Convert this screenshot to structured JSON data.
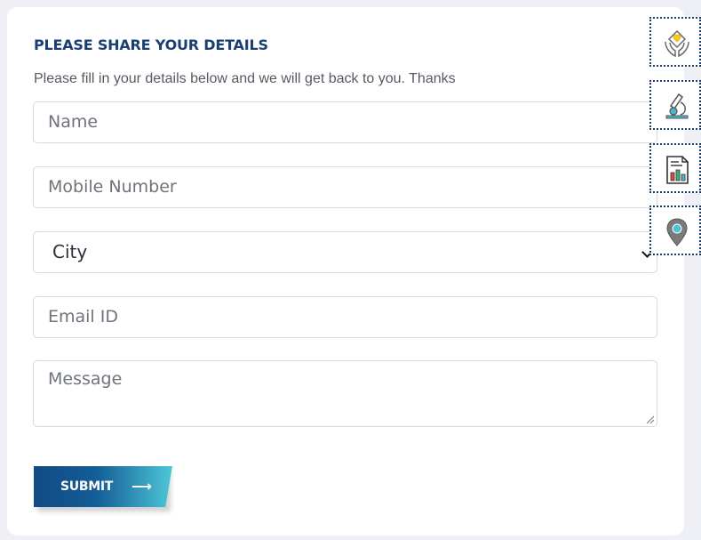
{
  "form": {
    "title": "PLEASE SHARE YOUR DETAILS",
    "subtitle": "Please fill in your details below and we will get back to you. Thanks",
    "name_placeholder": "Name",
    "mobile_placeholder": "Mobile Number",
    "city_selected": "City",
    "email_placeholder": "Email ID",
    "message_placeholder": "Message",
    "submit_label": "SUBMIT",
    "submit_arrow": "⟶"
  },
  "side_icons": [
    {
      "name": "care-hands-icon"
    },
    {
      "name": "microscope-icon"
    },
    {
      "name": "report-chart-icon"
    },
    {
      "name": "location-pin-icon"
    }
  ],
  "colors": {
    "title": "#1a3f73",
    "button_gradient_start": "#114a84",
    "button_gradient_end": "#4dc7d6",
    "side_border": "#1d3c6e"
  }
}
